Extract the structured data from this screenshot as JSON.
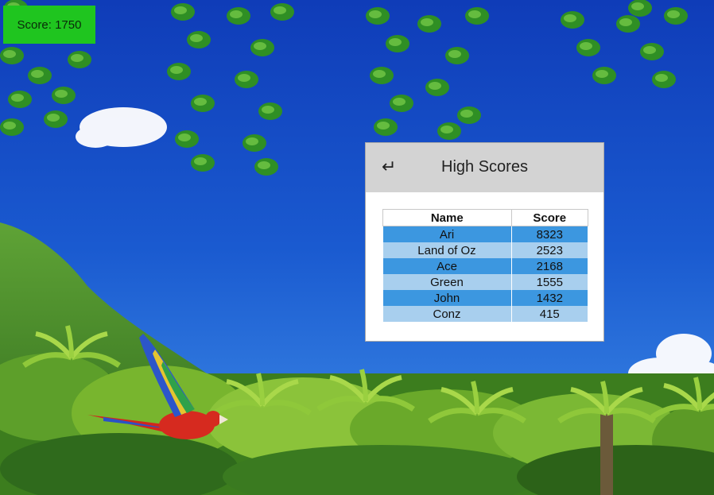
{
  "hud": {
    "score_label": "Score: 1750"
  },
  "high_scores": {
    "title": "High Scores",
    "back_icon_glyph": "↵",
    "headers": [
      "Name",
      "Score"
    ],
    "rows": [
      {
        "name": "Ari",
        "score": "8323"
      },
      {
        "name": "Land of Oz",
        "score": "2523"
      },
      {
        "name": "Ace",
        "score": "2168"
      },
      {
        "name": "Green",
        "score": "1555"
      },
      {
        "name": "John",
        "score": "1432"
      },
      {
        "name": "Conz",
        "score": "415"
      }
    ]
  },
  "colors": {
    "hud_green": "#1fc51f",
    "panel_header": "#d3d3d3",
    "row_dark": "#3c97e0",
    "row_light": "#a8cfee",
    "sky": "#1b4fc4"
  }
}
